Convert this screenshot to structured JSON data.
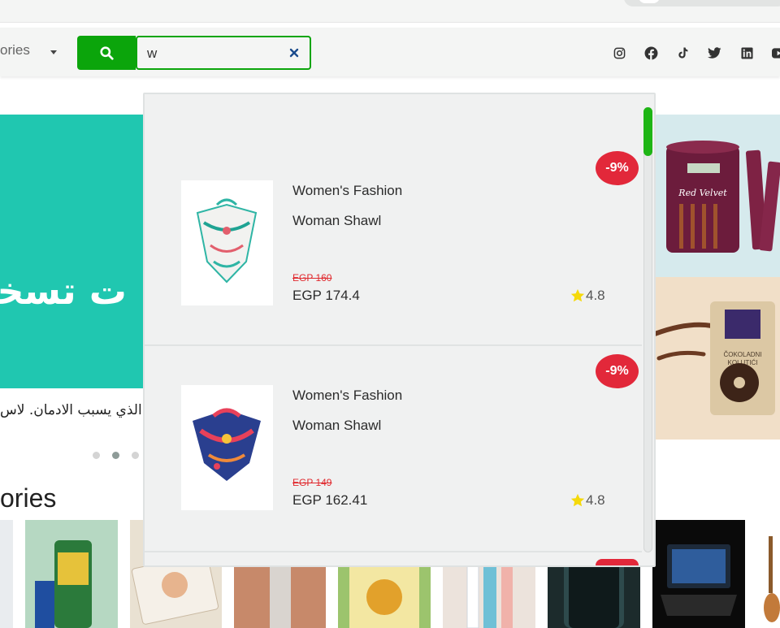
{
  "header": {
    "category_label": "ories",
    "search_value": "w",
    "social_icons": [
      "instagram-icon",
      "facebook-icon",
      "tiktok-icon",
      "twitter-icon",
      "linkedin-icon",
      "youtube-icon"
    ]
  },
  "hero": {
    "headline": "ت تسخين",
    "caption": "الذي يسبب الادمان. لاس",
    "dots": 3,
    "active_dot": 2
  },
  "section": {
    "categories_heading": "ories"
  },
  "results": [
    {
      "category": "Women's Fashion",
      "name": "Woman Shawl",
      "old_price": "EGP 160",
      "price": "EGP 174.4",
      "rating": "4.8",
      "discount": "-9%"
    },
    {
      "category": "Women's Fashion",
      "name": "Woman Shawl",
      "old_price": "EGP 149",
      "price": "EGP 162.41",
      "rating": "4.8",
      "discount": "-9%"
    }
  ],
  "colors": {
    "brand_green": "#0ba50b",
    "discount_red": "#e2283a",
    "hero_teal": "#20c7b0",
    "star_yellow": "#f5d90a"
  }
}
